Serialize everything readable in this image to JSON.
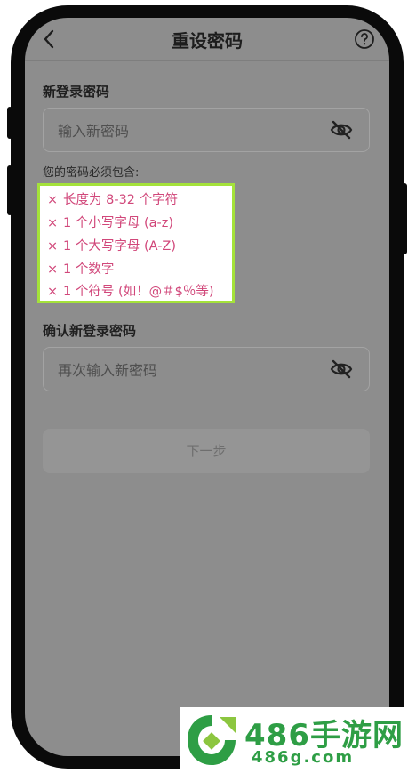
{
  "header": {
    "title": "重设密码",
    "back_icon": "back-chevron-icon",
    "help_icon": "help-circle-icon"
  },
  "new_password": {
    "label": "新登录密码",
    "placeholder": "输入新密码",
    "toggle_icon": "eye-off-icon"
  },
  "requirements": {
    "caption": "您的密码必须包含:",
    "mark": "×",
    "items": [
      "长度为 8-32 个字符",
      "1 个小写字母 (a-z)",
      "1 个大写字母 (A-Z)",
      "1 个数字",
      "1 个符号 (如！@＃$％等)"
    ],
    "highlight_color": "#a4e23a",
    "text_color": "#d1477a"
  },
  "confirm_password": {
    "label": "确认新登录密码",
    "placeholder": "再次输入新密码",
    "toggle_icon": "eye-off-icon"
  },
  "next_button": {
    "label": "下一步"
  },
  "watermark": {
    "text": "486手游网",
    "url": "486g.com",
    "color": "#2e9e45"
  }
}
